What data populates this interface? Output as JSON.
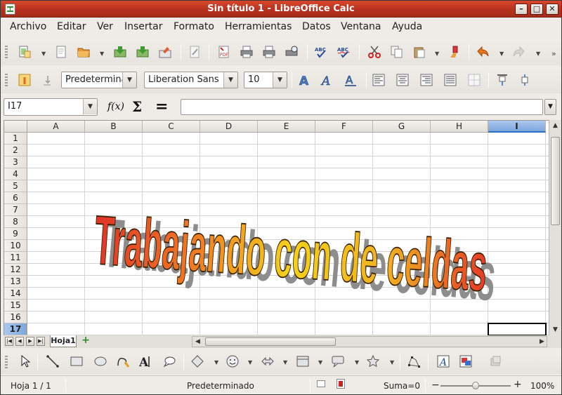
{
  "window": {
    "title": "Sin título 1 - LibreOffice Calc"
  },
  "menu": [
    "Archivo",
    "Editar",
    "Ver",
    "Insertar",
    "Formato",
    "Herramientas",
    "Datos",
    "Ventana",
    "Ayuda"
  ],
  "format_toolbar": {
    "style": "Predeterminado",
    "font": "Liberation Sans",
    "size": "10"
  },
  "formula_bar": {
    "name_box": "I17",
    "function_wizard": "f(x)",
    "sum": "Σ",
    "equals": "=",
    "content": ""
  },
  "sheet": {
    "columns": [
      "A",
      "B",
      "C",
      "D",
      "E",
      "F",
      "G",
      "H",
      "I"
    ],
    "rows": [
      "1",
      "2",
      "3",
      "4",
      "5",
      "6",
      "7",
      "8",
      "9",
      "10",
      "11",
      "12",
      "13",
      "14",
      "15",
      "16",
      "17"
    ],
    "selected_column": "I",
    "selected_row": "17",
    "fontwork_text": "Trabajando con de celdas"
  },
  "tabs": {
    "active": "Hoja1",
    "add": "+"
  },
  "status": {
    "page": "Hoja 1 / 1",
    "style": "Predeterminado",
    "sum": "Suma=0",
    "zoom": "100%",
    "zoom_level": 0.5
  }
}
